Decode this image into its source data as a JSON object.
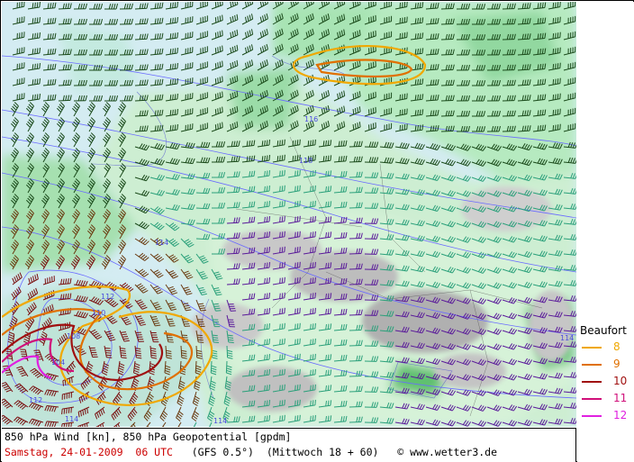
{
  "map": {
    "title_line": "850 hPa Wind [kn], 850 hPa Geopotential [gpdm]",
    "date": "Samstag, 24-01-2009  06 UTC",
    "model": "(GFS 0.5°)",
    "run": "(Mittwoch 18 + 60)",
    "copyright": "© www.wetter3.de",
    "contour_labels": [
      "116",
      "118",
      "108",
      "110",
      "112",
      "114",
      "114",
      "114",
      "112",
      "104",
      "114"
    ]
  },
  "legend": {
    "title": "Beaufort",
    "items": [
      {
        "label": "8",
        "color": "#f0a800"
      },
      {
        "label": "9",
        "color": "#e07000"
      },
      {
        "label": "10",
        "color": "#a01010"
      },
      {
        "label": "11",
        "color": "#d0107a"
      },
      {
        "label": "12",
        "color": "#e020e0"
      }
    ]
  },
  "colors": {
    "sea": "#d9eef4",
    "land": "#bfe6c8",
    "mountain": "#b8b8b8",
    "contour": "#6a6aff",
    "barb_sea": "#1a5a2a",
    "barb_land": "#2aa07a",
    "barb_alps": "#5a1a9a"
  }
}
